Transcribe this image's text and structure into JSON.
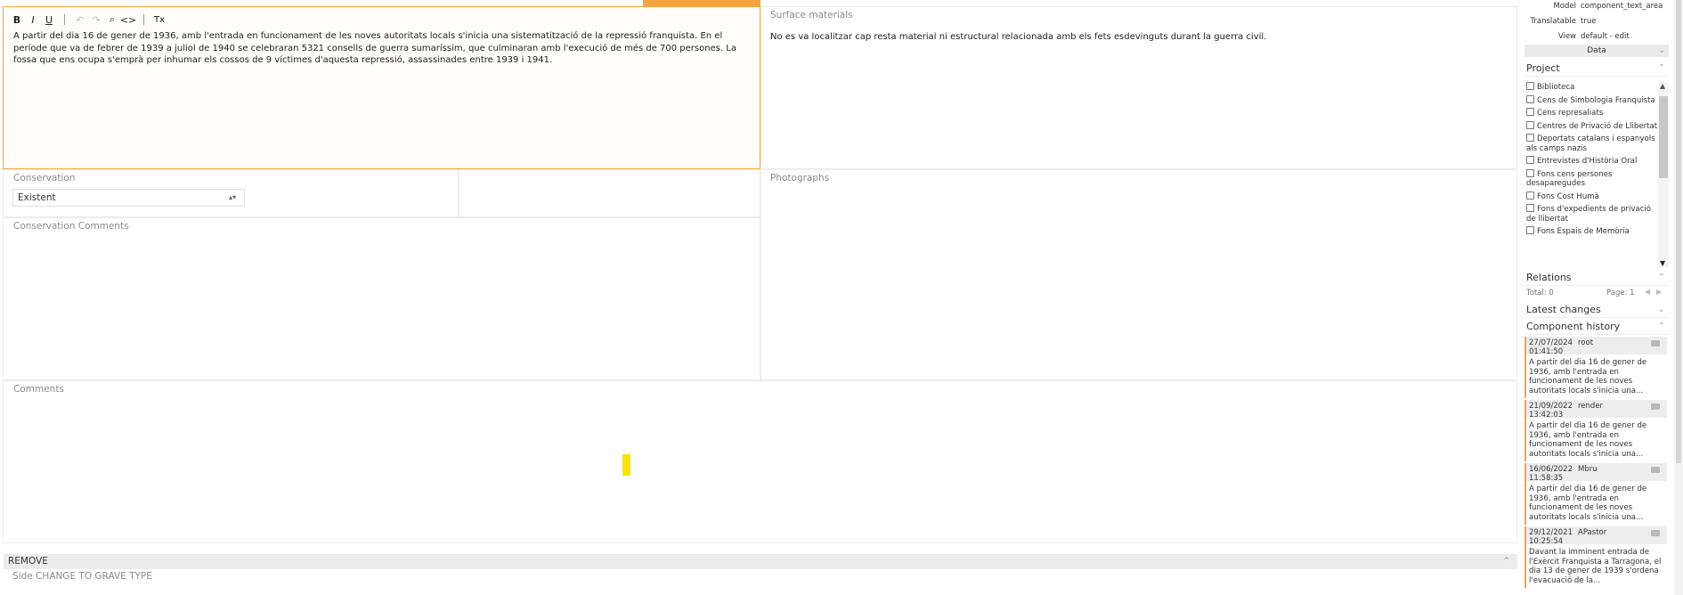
{
  "editor": {
    "toolbar": {
      "bold": "B",
      "italic": "I",
      "underline": "U",
      "undo": "↶",
      "redo": "↷",
      "search": "⌕",
      "code": "<>",
      "cursor": "I",
      "clear_format": "Tx"
    },
    "text": "A partir del dia 16 de gener de 1936, amb l'entrada en funcionament de les noves autoritats locals s'inicia una sistematització de la repressió franquista. En el període que va de febrer de 1939 a juliol de 1940 se celebraran 5321 consells de guerra sumaríssim, que culminaran amb l'execució de més de 700 persones. La fossa que ens ocupa s'emprà per inhumar els cossos de 9 víctimes d'aquesta repressió, assassinades entre 1939 i 1941."
  },
  "surface_materials": {
    "label": "Surface materials",
    "text": "No es va localitzar cap resta material ni estructural relacionada amb els fets esdevinguts durant la guerra civil."
  },
  "conservation": {
    "label": "Conservation",
    "value": "Existent"
  },
  "photographs": {
    "label": "Photographs"
  },
  "conservation_comments": {
    "label": "Conservation Comments"
  },
  "comments": {
    "label": "Comments"
  },
  "remove_bar": {
    "label": "REMOVE"
  },
  "side_label": "Side CHANGE TO GRAVE TYPE",
  "inspector": {
    "model_key": "Model",
    "model_value": "component_text_area",
    "translatable_key": "Translatable",
    "translatable_value": "true",
    "view_key": "View",
    "view_value": "default - edit",
    "data_label": "Data",
    "project_label": "Project",
    "projects": [
      "Biblioteca",
      "Cens de Simbologia Franquista",
      "Cens represaliats",
      "Centres de Privació de Llibertat",
      "Deportats catalans i espanyols als camps nazis",
      "Entrevistes d'Història Oral",
      "Fons cens persones desaparegudes",
      "Fons Cost Humà",
      "Fons d'expedients de privació de llibertat",
      "Fons Espais de Memòria"
    ],
    "relations_label": "Relations",
    "relations_total": "Total: 0",
    "relations_page": "Page: 1",
    "latest_changes_label": "Latest changes",
    "component_history_label": "Component history",
    "history": [
      {
        "date": "27/07/2024",
        "time": "01:41:50",
        "user": "root",
        "text": "A partir del dia 16 de gener de 1936, amb l'entrada en funcionament de les noves autoritats locals s'inicia una..."
      },
      {
        "date": "21/09/2022",
        "time": "13:42:03",
        "user": "render",
        "text": "A partir del dia 16 de gener de 1936, amb l'entrada en funcionament de les noves autoritats locals s'inicia una..."
      },
      {
        "date": "16/06/2022",
        "time": "11:58:35",
        "user": "Mbru",
        "text": "A partir del dia 16 de gener de 1936, amb l'entrada en funcionament de les noves autoritats locals s'inicia una..."
      },
      {
        "date": "29/12/2021",
        "time": "10:25:54",
        "user": "APastor",
        "text": "Davant la imminent entrada de l'Exèrcit Franquista a Tarragona, el dia 13 de gener de 1939 s'ordena l'evacuació de la..."
      }
    ]
  }
}
